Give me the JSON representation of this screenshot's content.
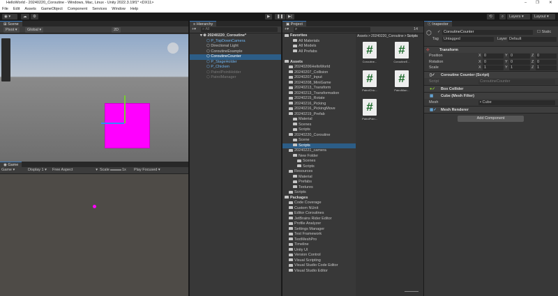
{
  "window": {
    "title": "HelloWorld - 20240220_Coroutine - Windows, Mac, Linux - Unity 2022.3.19f1* <DX11>",
    "minimize": "–",
    "restore": "❐",
    "close": "✕"
  },
  "menu": [
    "File",
    "Edit",
    "Assets",
    "GameObject",
    "Component",
    "Services",
    "Window",
    "Help"
  ],
  "toolbar": {
    "layers": "Layers",
    "layout": "Layout",
    "play": "▶",
    "pause": "❚❚",
    "step": "▶|"
  },
  "scene": {
    "tab": "Scene",
    "pivot": "Pivot",
    "global": "Global",
    "mode2d": "2D"
  },
  "game": {
    "tab": "Game",
    "mode": "Game",
    "display": "Display 1",
    "aspect": "Free Aspect",
    "scale_label": "Scale",
    "scale_value": "1x",
    "play_focused": "Play Focused"
  },
  "hierarchy": {
    "tab": "Hierarchy",
    "search": "All",
    "scene": "20240220_Coroutine*",
    "items": [
      {
        "label": "P_TopDownCamera",
        "style": "blue"
      },
      {
        "label": "Directional Light",
        "style": ""
      },
      {
        "label": "CoroutineExample",
        "style": ""
      },
      {
        "label": "CoroutineCounter",
        "style": "sel"
      },
      {
        "label": "P_StageHolder",
        "style": "blue muted"
      },
      {
        "label": "P_Chicken",
        "style": "blue muted"
      },
      {
        "label": "PatrolPointHolder",
        "style": "muted"
      },
      {
        "label": "PatrolManager",
        "style": "muted"
      }
    ]
  },
  "project": {
    "tab": "Project",
    "hidden_count": "14",
    "breadcrumb": [
      "Assets",
      "20240220_Coroutine",
      "Scripts"
    ],
    "tree": [
      {
        "label": "Favorites",
        "d": 0,
        "bold": true
      },
      {
        "label": "All Materials",
        "d": 2
      },
      {
        "label": "All Models",
        "d": 2
      },
      {
        "label": "All Prefabs",
        "d": 2
      },
      {
        "label": "",
        "d": 0
      },
      {
        "label": "Assets",
        "d": 0,
        "bold": true
      },
      {
        "label": "20240206HelloWorld",
        "d": 1
      },
      {
        "label": "20240207_Collision",
        "d": 1
      },
      {
        "label": "20240207_Input",
        "d": 1
      },
      {
        "label": "20240208_MiniGame",
        "d": 1
      },
      {
        "label": "20240213_Transform",
        "d": 1
      },
      {
        "label": "20240213_Transformation",
        "d": 1
      },
      {
        "label": "20240215_Rotate",
        "d": 1
      },
      {
        "label": "20240216_Picking",
        "d": 1
      },
      {
        "label": "20240216_PickingMove",
        "d": 1
      },
      {
        "label": "20240219_Prefab",
        "d": 1
      },
      {
        "label": "Material",
        "d": 2
      },
      {
        "label": "Scenes",
        "d": 2
      },
      {
        "label": "Scripts",
        "d": 2
      },
      {
        "label": "20240220_Coroutine",
        "d": 1
      },
      {
        "label": "Scene",
        "d": 2
      },
      {
        "label": "Scripts",
        "d": 2,
        "sel": true
      },
      {
        "label": "20240221_camera",
        "d": 1
      },
      {
        "label": "New Folder",
        "d": 2
      },
      {
        "label": "Scenes",
        "d": 3
      },
      {
        "label": "Scripts",
        "d": 3
      },
      {
        "label": "Resources",
        "d": 1
      },
      {
        "label": "Material",
        "d": 2
      },
      {
        "label": "Prefabs",
        "d": 2
      },
      {
        "label": "Textures",
        "d": 2
      },
      {
        "label": "Scripts",
        "d": 1
      },
      {
        "label": "Packages",
        "d": 0,
        "bold": true
      },
      {
        "label": "Code Coverage",
        "d": 1
      },
      {
        "label": "Custom NUnit",
        "d": 1
      },
      {
        "label": "Editor Coroutines",
        "d": 1
      },
      {
        "label": "JetBrains Rider Editor",
        "d": 1
      },
      {
        "label": "Profile Analyzer",
        "d": 1
      },
      {
        "label": "Settings Manager",
        "d": 1
      },
      {
        "label": "Test Framework",
        "d": 1
      },
      {
        "label": "TextMeshPro",
        "d": 1
      },
      {
        "label": "Timeline",
        "d": 1
      },
      {
        "label": "Unity UI",
        "d": 1
      },
      {
        "label": "Version Control",
        "d": 1
      },
      {
        "label": "Visual Scripting",
        "d": 1
      },
      {
        "label": "Visual Studio Code Editor",
        "d": 1
      },
      {
        "label": "Visual Studio Editor",
        "d": 1
      }
    ],
    "files": [
      "Coroutine...",
      "CoroutineE...",
      "PatrolChic...",
      "PatrolMan...",
      "PatrolPoin..."
    ],
    "file_icon": "#"
  },
  "inspector": {
    "tab": "Inspector",
    "name": "CoroutineCounter",
    "static": "Static",
    "tag_label": "Tag",
    "tag": "Untagged",
    "layer_label": "Layer",
    "layer": "Default",
    "transform": {
      "title": "Transform",
      "rows": [
        {
          "label": "Position",
          "x": "0",
          "y": "0",
          "z": "0"
        },
        {
          "label": "Rotation",
          "x": "0",
          "y": "0",
          "z": "0"
        },
        {
          "label": "Scale",
          "x": "1",
          "y": "1",
          "z": "1"
        }
      ]
    },
    "script_comp": {
      "title": "Coroutine Counter (Script)",
      "label": "Script",
      "value": "CoroutineCounter"
    },
    "box_collider": "Box Collider",
    "mesh_filter": {
      "title": "Cube (Mesh Filter)",
      "label": "Mesh",
      "value": "Cube"
    },
    "mesh_renderer": "Mesh Renderer",
    "add_component": "Add Component"
  }
}
